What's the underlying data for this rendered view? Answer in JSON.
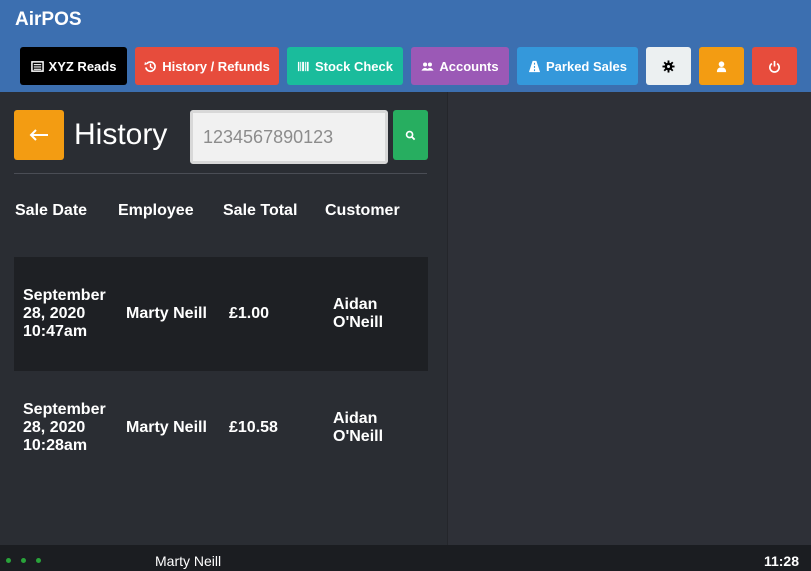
{
  "app": {
    "title": "AirPOS"
  },
  "toolbar": {
    "buttons": [
      {
        "label": "XYZ Reads",
        "icon": "list-icon",
        "color": "#000000"
      },
      {
        "label": "History / Refunds",
        "icon": "history-icon",
        "color": "#e74c3c"
      },
      {
        "label": "Stock Check",
        "icon": "barcode-icon",
        "color": "#1abc9c"
      },
      {
        "label": "Accounts",
        "icon": "users-icon",
        "color": "#9b59b6"
      },
      {
        "label": "Parked Sales",
        "icon": "road-icon",
        "color": "#3498db"
      },
      {
        "label": "",
        "icon": "gear-icon",
        "color": "#ecf0f1"
      },
      {
        "label": "",
        "icon": "user-icon",
        "color": "#f39c12"
      },
      {
        "label": "",
        "icon": "power-icon",
        "color": "#e74c3c"
      }
    ]
  },
  "history": {
    "title": "History",
    "search_placeholder": "1234567890123",
    "columns": [
      "Sale Date",
      "Employee",
      "Sale Total",
      "Customer"
    ],
    "rows": [
      {
        "date": [
          "September",
          "28, 2020",
          "10:47am"
        ],
        "employee": "Marty Neill",
        "total": "£1.00",
        "customer": [
          "Aidan",
          "O'Neill"
        ]
      },
      {
        "date": [
          "September",
          "28, 2020",
          "10:28am"
        ],
        "employee": "Marty Neill",
        "total": "£10.58",
        "customer": [
          "Aidan",
          "O'Neill"
        ]
      }
    ]
  },
  "status": {
    "user": "Marty Neill",
    "time": "11:28"
  },
  "colors": {
    "header": "#3c6fb0",
    "back": "#f39c12",
    "search": "#27ae60"
  }
}
